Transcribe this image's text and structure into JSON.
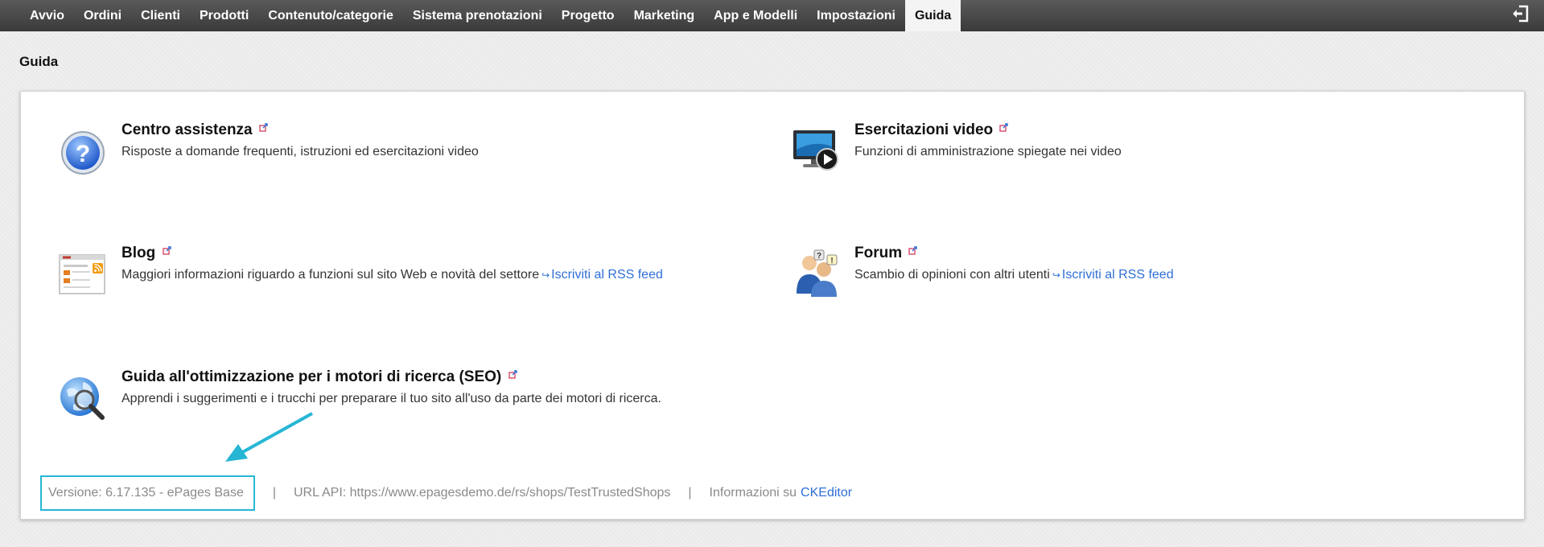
{
  "nav": {
    "items": [
      {
        "label": "Avvio"
      },
      {
        "label": "Ordini"
      },
      {
        "label": "Clienti"
      },
      {
        "label": "Prodotti"
      },
      {
        "label": "Contenuto/categorie"
      },
      {
        "label": "Sistema prenotazioni"
      },
      {
        "label": "Progetto"
      },
      {
        "label": "Marketing"
      },
      {
        "label": "App e Modelli"
      },
      {
        "label": "Impostazioni"
      },
      {
        "label": "Guida"
      }
    ],
    "active": "Guida",
    "logout_icon": "logout-icon"
  },
  "page": {
    "title": "Guida"
  },
  "entries": {
    "help_center": {
      "title": "Centro assistenza",
      "desc": "Risposte a domande frequenti, istruzioni ed esercitazioni video",
      "icon": "help-question-icon"
    },
    "video": {
      "title": "Esercitazioni video",
      "desc": "Funzioni di amministrazione spiegate nei video",
      "icon": "video-monitor-icon"
    },
    "blog": {
      "title": "Blog",
      "desc": "Maggiori informazioni riguardo a funzioni sul sito Web e novità del settore",
      "rss": "Iscriviti al RSS feed",
      "icon": "blog-rss-icon"
    },
    "forum": {
      "title": "Forum",
      "desc": "Scambio di opinioni con altri utenti",
      "rss": "Iscriviti al RSS feed",
      "icon": "forum-users-icon"
    },
    "seo": {
      "title": "Guida all'ottimizzazione per i motori di ricerca (SEO)",
      "desc": "Apprendi i suggerimenti e i trucchi per preparare il tuo sito all'uso da parte dei motori di ricerca.",
      "icon": "seo-globe-magnifier-icon"
    }
  },
  "footer": {
    "version": "Versione: 6.17.135 - ePages Base",
    "sep": "|",
    "api_url": "URL API: https://www.epagesdemo.de/rs/shops/TestTrustedShops",
    "info_prefix": "Informazioni su",
    "info_link": "CKEditor"
  },
  "colors": {
    "accent": "#26b6d4",
    "link": "#2f6fd6",
    "nav_bg": "#3f3f3f"
  }
}
